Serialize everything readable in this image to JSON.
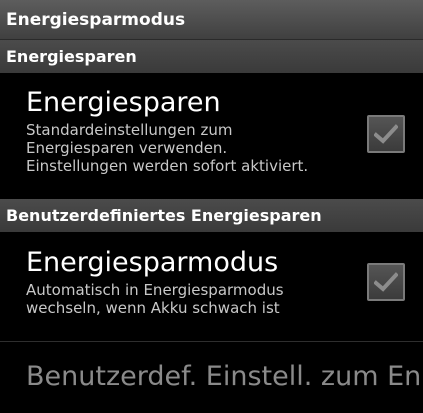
{
  "title_bar": {
    "title": "Energiesparmodus"
  },
  "sections": [
    {
      "header": "Energiesparen",
      "item": {
        "title": "Energiesparen",
        "summary_lines": [
          "Standardeinstellungen zum",
          "Energiesparen verwenden.",
          "Einstellungen werden sofort aktiviert."
        ],
        "checked": true,
        "enabled": false
      }
    },
    {
      "header": "Benutzerdefiniertes Energiesparen",
      "item": {
        "title": "Energiesparmodus",
        "summary_lines": [
          "Automatisch in Energiesparmodus",
          "wechseln, wenn Akku schwach ist"
        ],
        "checked": true,
        "enabled": false
      }
    }
  ],
  "partial_item": {
    "title": "Benutzerdef. Einstell. zum En"
  },
  "colors": {
    "background": "#000000",
    "title_bar": "#4f4f4f",
    "section_header": "#434343",
    "summary_text": "#c8c8c8",
    "disabled_text": "#8a8a8a",
    "checkbox_fill": "#4a4a4a",
    "checkmark": "#8c8c8c"
  }
}
